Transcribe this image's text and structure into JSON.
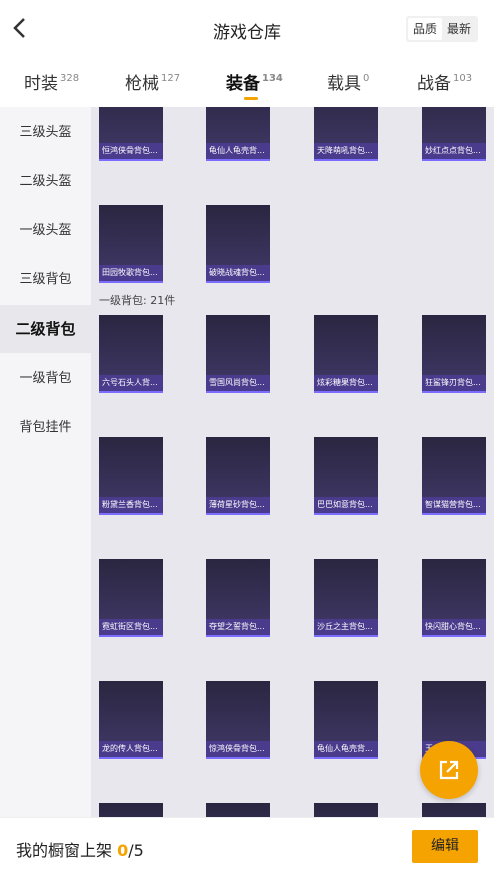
{
  "header": {
    "title": "游戏仓库",
    "sort_options": [
      "品质",
      "最新"
    ]
  },
  "tabs": [
    {
      "label": "时装",
      "count": "328"
    },
    {
      "label": "枪械",
      "count": "127"
    },
    {
      "label": "装备",
      "count": "134"
    },
    {
      "label": "载具",
      "count": "0"
    },
    {
      "label": "战备",
      "count": "103"
    }
  ],
  "sidebar": [
    {
      "label": "三级头盔"
    },
    {
      "label": "二级头盔"
    },
    {
      "label": "一级头盔"
    },
    {
      "label": "三级背包"
    },
    {
      "label": "二级背包"
    },
    {
      "label": "一级背包"
    },
    {
      "label": "背包挂件"
    }
  ],
  "grid": {
    "top_row": [
      "恒鸿侠骨背包...",
      "龟仙人龟壳背...",
      "天降萌吼背包...",
      "妙红点点背包..."
    ],
    "second_row": [
      "田园牧歌背包...",
      "破晓战魂背包..."
    ],
    "section_label": "一级背包: 21件",
    "level1_items": [
      "六号石头人背...",
      "雪国风尚背包...",
      "炫彩糖果背包...",
      "狂鲨锋刃背包...",
      "粉黛兰香背包...",
      "薄荷星砂背包...",
      "巴巴如意背包...",
      "智谋猫营背包...",
      "霓虹街区背包...",
      "夺望之誓背包...",
      "沙丘之主背包...",
      "快闪甜心背包...",
      "龙的传人背包...",
      "惊鸿侠骨背包...",
      "龟仙人龟壳背...",
      "王..."
    ]
  },
  "bottom": {
    "text": "我的橱窗上架",
    "count": "0",
    "total": "/5",
    "edit_label": "编辑"
  },
  "colors": {
    "accent": "#f5a300",
    "label_bg": "#4a3b8c"
  }
}
